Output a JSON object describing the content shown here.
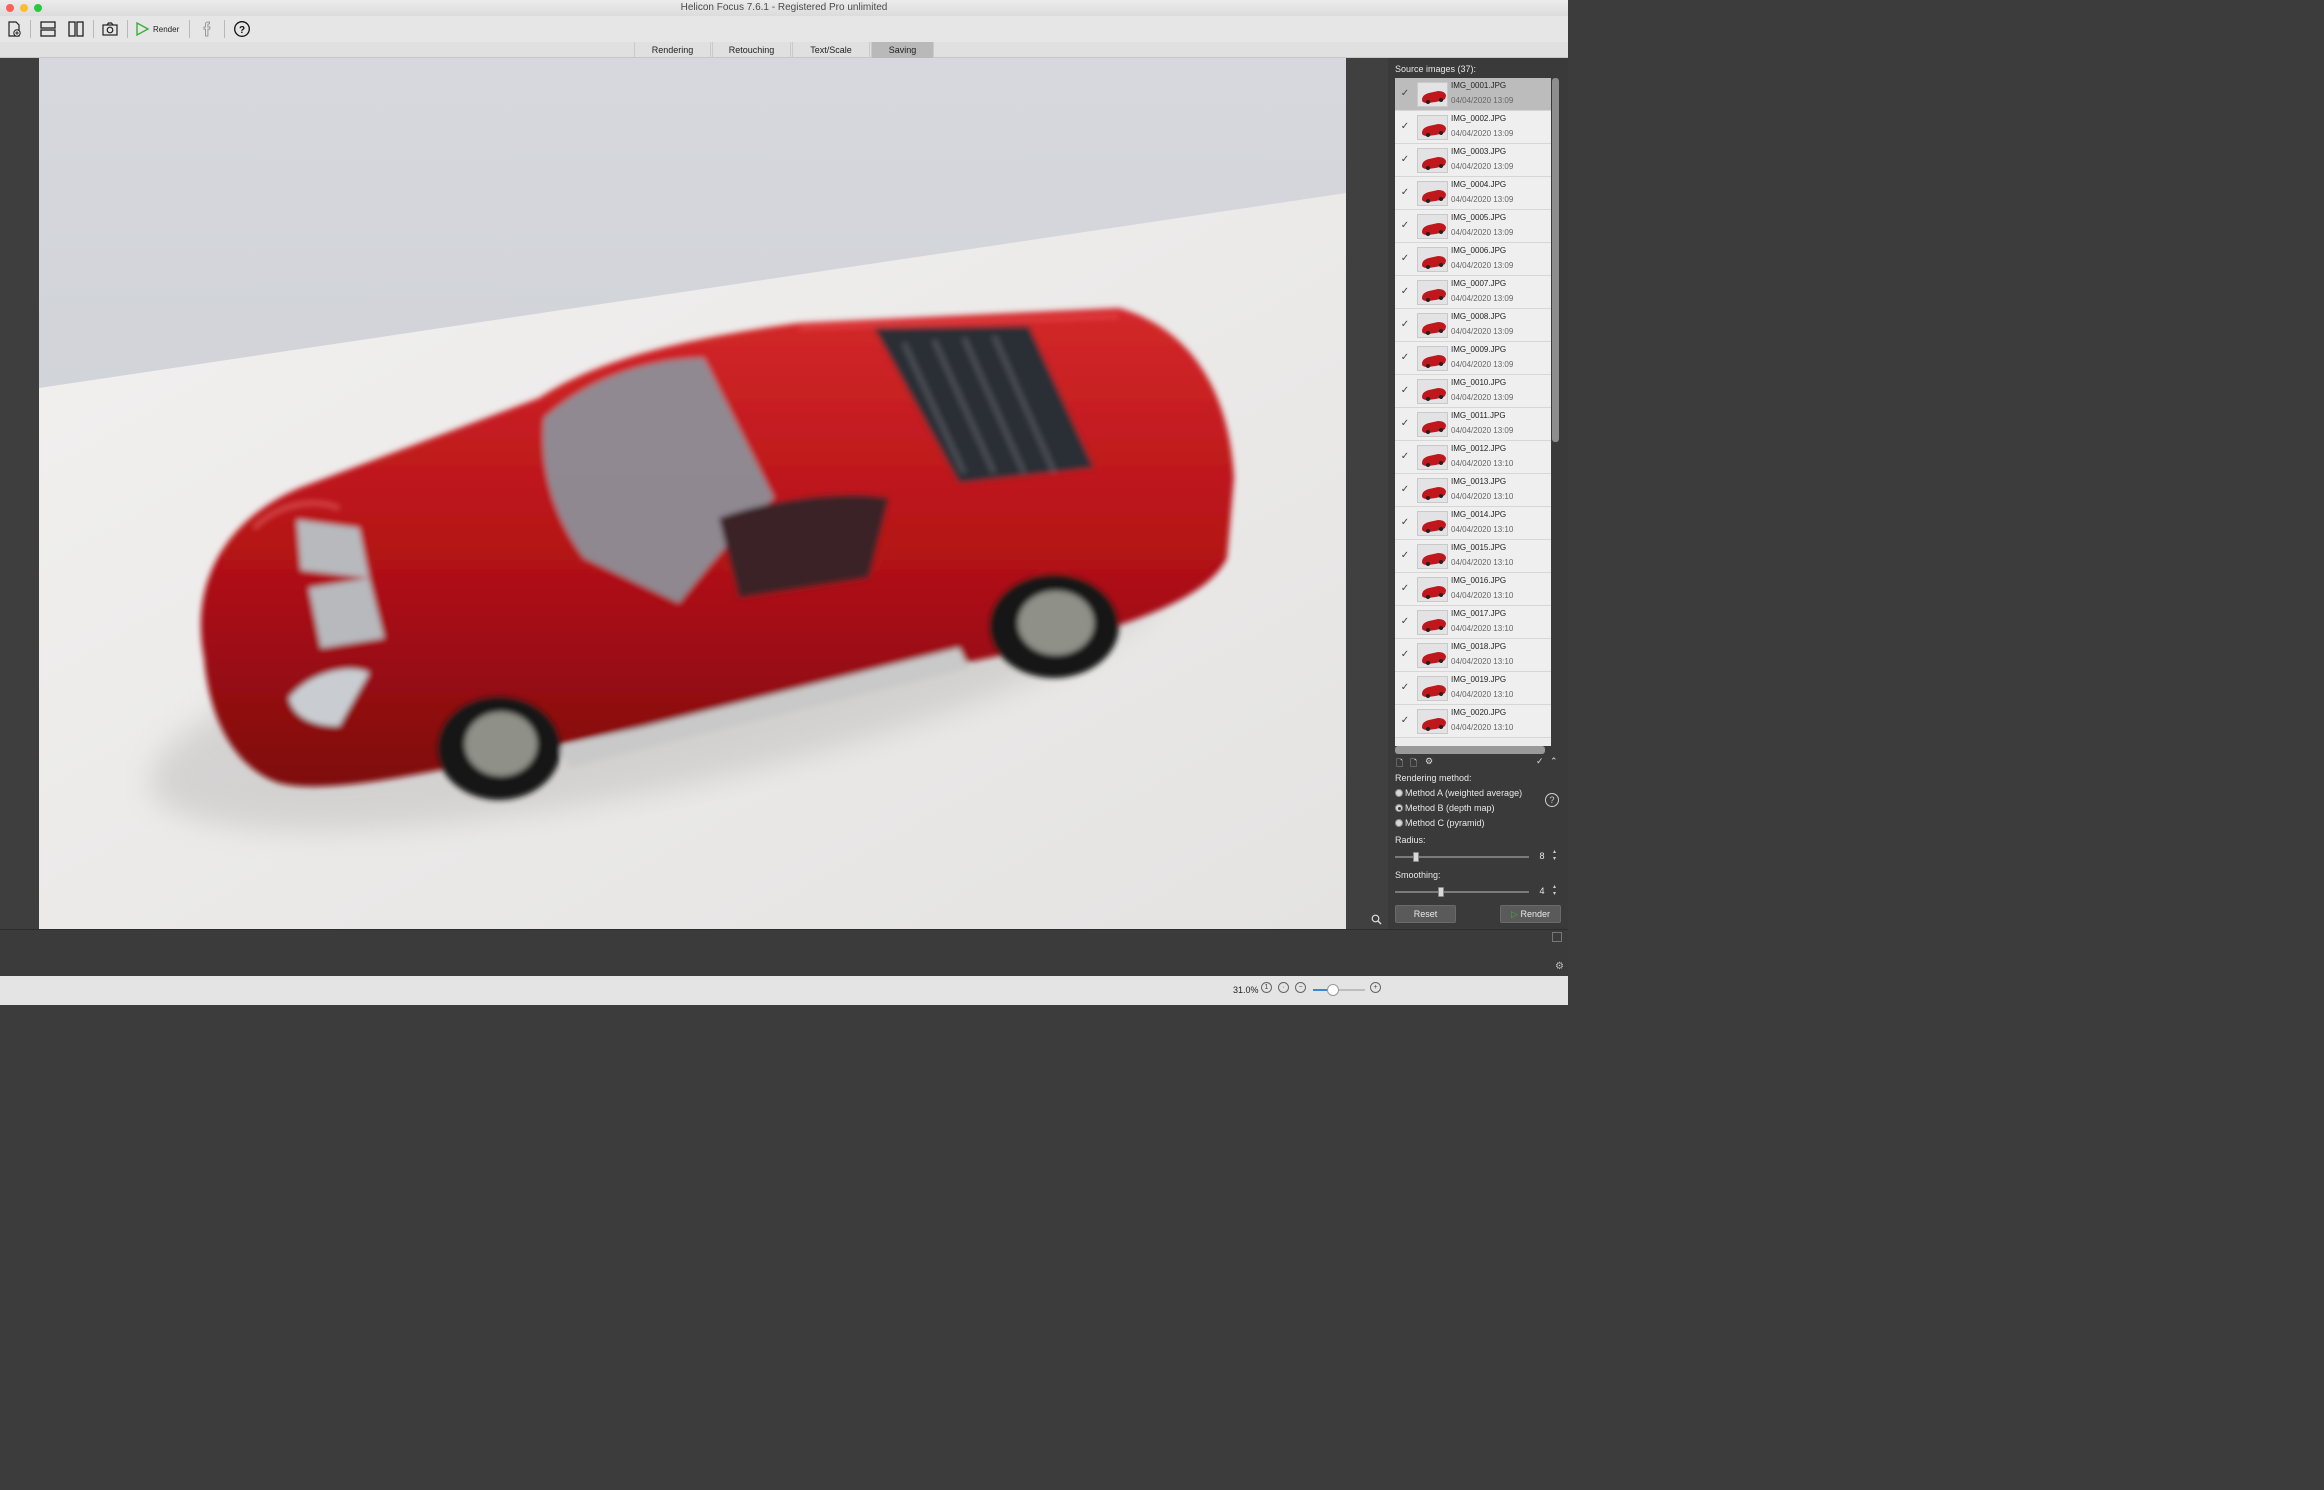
{
  "window": {
    "title": "Helicon Focus 7.6.1 - Registered Pro unlimited"
  },
  "toolbar": {
    "render_label": "Render"
  },
  "tabs": [
    "Rendering",
    "Retouching",
    "Text/Scale",
    "Saving"
  ],
  "active_tab": "Saving",
  "source": {
    "header": "Source images (37):",
    "files": [
      {
        "name": "IMG_0001.JPG",
        "date": "04/04/2020 13:09",
        "checked": true,
        "selected": true
      },
      {
        "name": "IMG_0002.JPG",
        "date": "04/04/2020 13:09",
        "checked": true
      },
      {
        "name": "IMG_0003.JPG",
        "date": "04/04/2020 13:09",
        "checked": true
      },
      {
        "name": "IMG_0004.JPG",
        "date": "04/04/2020 13:09",
        "checked": true
      },
      {
        "name": "IMG_0005.JPG",
        "date": "04/04/2020 13:09",
        "checked": true
      },
      {
        "name": "IMG_0006.JPG",
        "date": "04/04/2020 13:09",
        "checked": true
      },
      {
        "name": "IMG_0007.JPG",
        "date": "04/04/2020 13:09",
        "checked": true
      },
      {
        "name": "IMG_0008.JPG",
        "date": "04/04/2020 13:09",
        "checked": true
      },
      {
        "name": "IMG_0009.JPG",
        "date": "04/04/2020 13:09",
        "checked": true
      },
      {
        "name": "IMG_0010.JPG",
        "date": "04/04/2020 13:09",
        "checked": true
      },
      {
        "name": "IMG_0011.JPG",
        "date": "04/04/2020 13:09",
        "checked": true
      },
      {
        "name": "IMG_0012.JPG",
        "date": "04/04/2020 13:10",
        "checked": true
      },
      {
        "name": "IMG_0013.JPG",
        "date": "04/04/2020 13:10",
        "checked": true
      },
      {
        "name": "IMG_0014.JPG",
        "date": "04/04/2020 13:10",
        "checked": true
      },
      {
        "name": "IMG_0015.JPG",
        "date": "04/04/2020 13:10",
        "checked": true
      },
      {
        "name": "IMG_0016.JPG",
        "date": "04/04/2020 13:10",
        "checked": true
      },
      {
        "name": "IMG_0017.JPG",
        "date": "04/04/2020 13:10",
        "checked": true
      },
      {
        "name": "IMG_0018.JPG",
        "date": "04/04/2020 13:10",
        "checked": true
      },
      {
        "name": "IMG_0019.JPG",
        "date": "04/04/2020 13:10",
        "checked": true
      },
      {
        "name": "IMG_0020.JPG",
        "date": "04/04/2020 13:10",
        "checked": true
      }
    ]
  },
  "rendering": {
    "method_label": "Rendering method:",
    "methods": [
      "Method A (weighted average)",
      "Method B (depth map)",
      "Method C (pyramid)"
    ],
    "selected_method": 1,
    "radius_label": "Radius:",
    "radius_value": "8",
    "smoothing_label": "Smoothing:",
    "smoothing_value": "4",
    "reset_label": "Reset",
    "render_label": "Render"
  },
  "status": {
    "zoom": "31.0%"
  },
  "colors": {
    "accent": "#3b86d8",
    "car": "#c0171c",
    "render_green": "#3cae3c"
  }
}
